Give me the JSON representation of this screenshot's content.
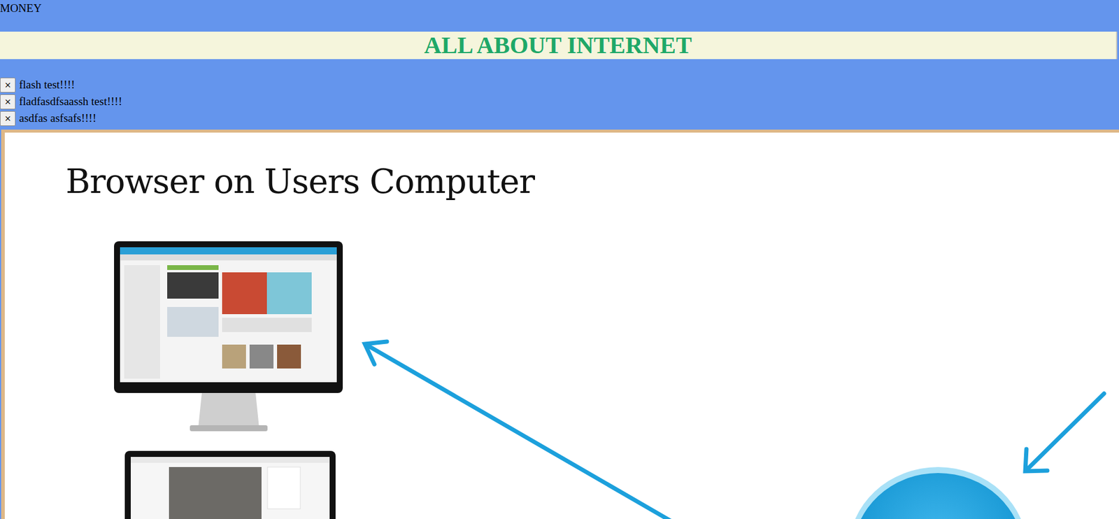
{
  "page": {
    "top_label": "MONEY"
  },
  "banner": {
    "title": "ALL ABOUT INTERNET"
  },
  "flashes": [
    {
      "close": "×",
      "message": "flash test!!!!"
    },
    {
      "close": "×",
      "message": "fladfasdfsaassh test!!!!"
    },
    {
      "close": "×",
      "message": "asdfas asfsafs!!!!"
    }
  ],
  "diagram": {
    "title": "Browser on Users Computer"
  }
}
